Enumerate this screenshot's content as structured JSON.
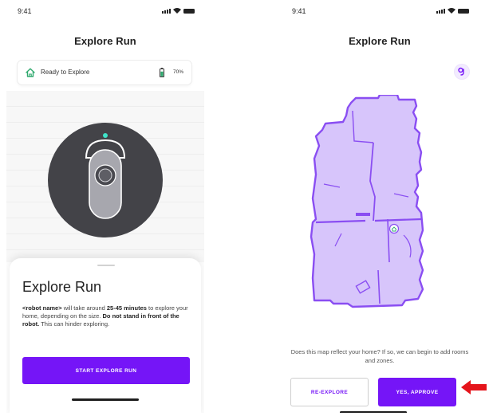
{
  "left_screen": {
    "status_time": "9:41",
    "title": "Explore Run",
    "status_card": {
      "label": "Ready to Explore",
      "battery": "70%"
    },
    "sheet": {
      "title": "Explore Run",
      "desc_robot_name": "<robot name>",
      "desc_part1": " will take around ",
      "desc_duration": "25-45 minutes",
      "desc_part2": " to explore your home, depending on the size. ",
      "desc_warning": "Do not stand in front of the robot.",
      "desc_part3": " This can hinder exploring."
    },
    "start_button_label": "START EXPLORE RUN"
  },
  "right_screen": {
    "status_time": "9:41",
    "title": "Explore Run",
    "question": "Does this map reflect your home? If so, we can begin to add rooms and zones.",
    "reexplore_label": "RE-EXPLORE",
    "approve_label": "YES, APPROVE"
  },
  "icons": {
    "home": "home-icon",
    "battery": "battery-icon",
    "robot": "robot-icon",
    "avatar": "avatar-icon",
    "map": "floor-map",
    "arrow": "arrow-left-icon"
  },
  "colors": {
    "accent": "#7515f7",
    "map_fill": "#d7c5fb",
    "map_stroke": "#8a4ef2",
    "robot_body": "#434348",
    "home_icon": "#2fa96e",
    "arrow": "#e5141b"
  }
}
